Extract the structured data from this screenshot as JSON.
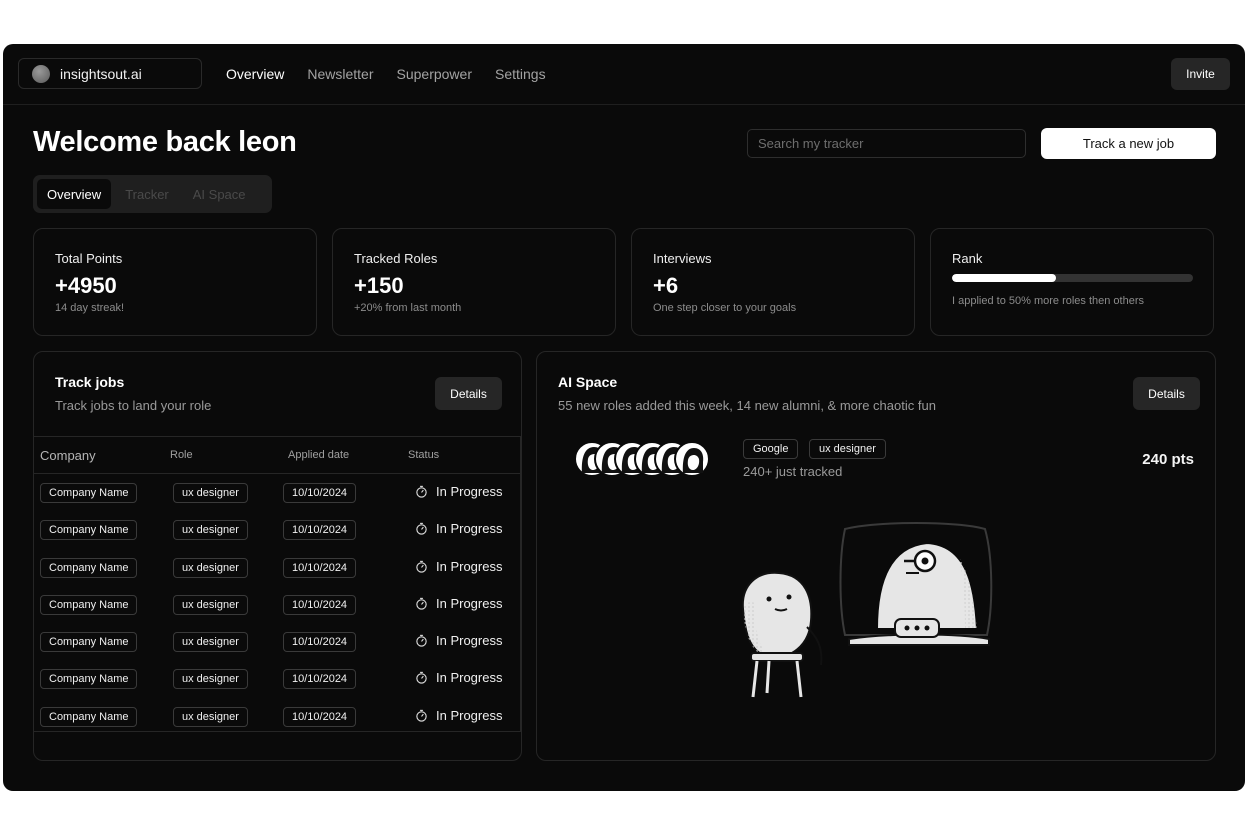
{
  "brand": {
    "name": "insightsout.ai"
  },
  "nav": [
    {
      "label": "Overview",
      "active": true
    },
    {
      "label": "Newsletter",
      "active": false
    },
    {
      "label": "Superpower",
      "active": false
    },
    {
      "label": "Settings",
      "active": false
    }
  ],
  "header": {
    "invite_label": "Invite",
    "title": "Welcome back leon",
    "search_placeholder": "Search my tracker",
    "track_button": "Track a new job"
  },
  "subtabs": [
    {
      "label": "Overview",
      "active": true
    },
    {
      "label": "Tracker",
      "active": false
    },
    {
      "label": "AI Space",
      "active": false
    }
  ],
  "stats": {
    "points": {
      "label": "Total Points",
      "value": "+4950",
      "sub": "14 day streak!"
    },
    "roles": {
      "label": "Tracked Roles",
      "value": "+150",
      "sub": "+20% from last month"
    },
    "interviews": {
      "label": "Interviews",
      "value": "+6",
      "sub": "One step closer to your goals"
    },
    "rank": {
      "label": "Rank",
      "progress": 0.43,
      "sub": "I applied to 50% more roles then others"
    }
  },
  "track_jobs": {
    "title": "Track jobs",
    "subtitle": "Track jobs to land your role",
    "details": "Details",
    "columns": {
      "company": "Company",
      "role": "Role",
      "applied": "Applied date",
      "status": "Status"
    },
    "rows": [
      {
        "company": "Company Name",
        "role": "ux designer",
        "date": "10/10/2024",
        "status": "In Progress"
      },
      {
        "company": "Company Name",
        "role": "ux designer",
        "date": "10/10/2024",
        "status": "In Progress"
      },
      {
        "company": "Company Name",
        "role": "ux designer",
        "date": "10/10/2024",
        "status": "In Progress"
      },
      {
        "company": "Company Name",
        "role": "ux designer",
        "date": "10/10/2024",
        "status": "In Progress"
      },
      {
        "company": "Company Name",
        "role": "ux designer",
        "date": "10/10/2024",
        "status": "In Progress"
      },
      {
        "company": "Company Name",
        "role": "ux designer",
        "date": "10/10/2024",
        "status": "In Progress"
      },
      {
        "company": "Company Name",
        "role": "ux designer",
        "date": "10/10/2024",
        "status": "In Progress"
      }
    ]
  },
  "ai_space": {
    "title": "AI Space",
    "subtitle": "55 new roles added this week, 14 new alumni, & more chaotic fun",
    "details": "Details",
    "tags": [
      "Google",
      "ux designer"
    ],
    "tracked": "240+ just tracked",
    "points": "240 pts"
  },
  "colors": {
    "background": "#0a0a0a",
    "border": "#262626",
    "accent": "#ffffff"
  }
}
